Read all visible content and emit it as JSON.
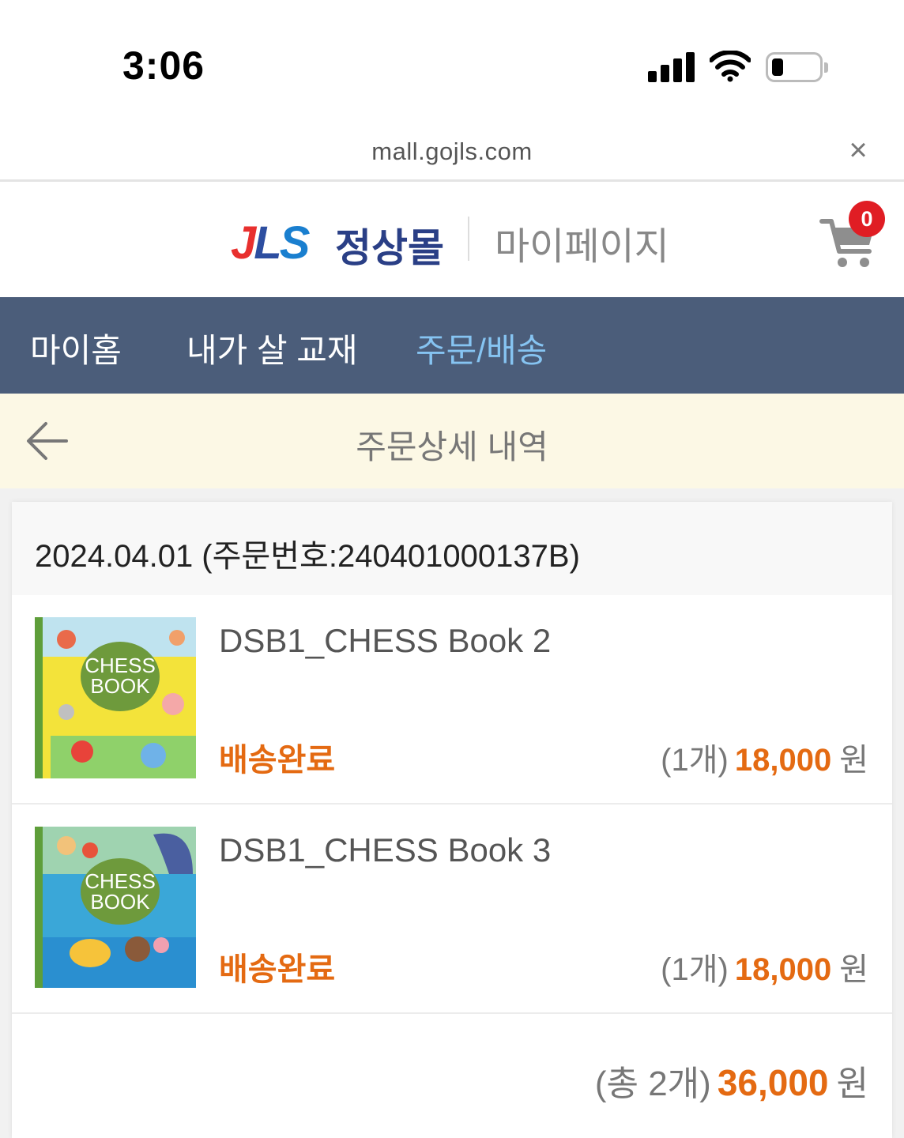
{
  "status_bar": {
    "time": "3:06",
    "signal_icon": "cellular-signal-icon",
    "wifi_icon": "wifi-icon",
    "battery_icon": "battery-icon"
  },
  "browser": {
    "url": "mall.gojls.com",
    "close_label": "×"
  },
  "header": {
    "logo_text": "JLS",
    "logo_name": "정상몰",
    "title": "마이페이지",
    "cart_count": "0"
  },
  "nav": {
    "items": [
      {
        "label": "마이홈",
        "active": false
      },
      {
        "label": "내가 살 교재",
        "active": false
      },
      {
        "label": "주문/배송",
        "active": true
      }
    ]
  },
  "page": {
    "title": "주문상세 내역"
  },
  "order": {
    "header": "2024.04.01 (주문번호:240401000137B)",
    "items": [
      {
        "name": "DSB1_CHESS Book 2",
        "status": "배송완료",
        "quantity": "(1개)",
        "price": "18,000",
        "currency": "원",
        "cover_text_1": "CHESS",
        "cover_text_2": "BOOK",
        "cover_color": "#f3e33a"
      },
      {
        "name": "DSB1_CHESS Book 3",
        "status": "배송완료",
        "quantity": "(1개)",
        "price": "18,000",
        "currency": "원",
        "cover_text_1": "CHESS",
        "cover_text_2": "BOOK",
        "cover_color": "#3aa7d8"
      }
    ],
    "total": {
      "quantity": "(총 2개)",
      "price": "36,000",
      "currency": "원"
    }
  },
  "colors": {
    "nav_bg": "#4b5d7a",
    "nav_active": "#86c4f2",
    "accent_orange": "#e46a12",
    "page_header_bg": "#fcf8e5",
    "badge_red": "#e01d24"
  }
}
